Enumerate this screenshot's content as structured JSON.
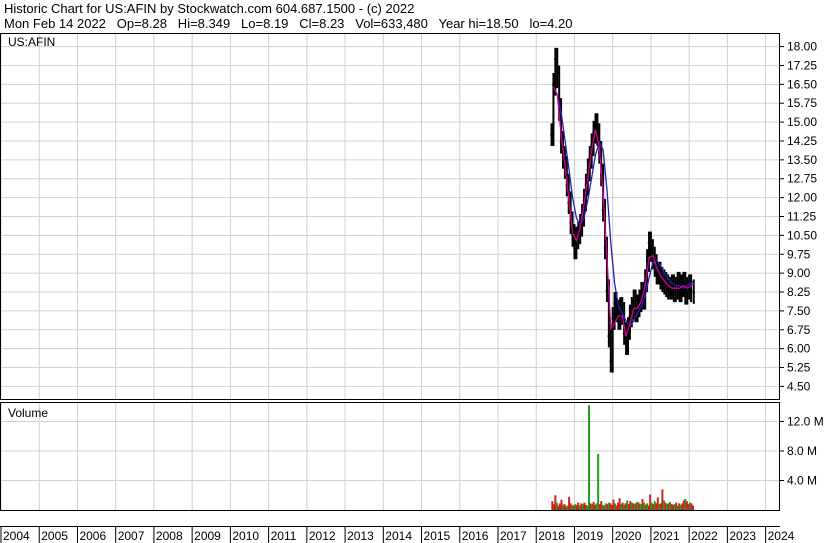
{
  "header": {
    "line1": "Historic Chart for US:AFIN by Stockwatch.com 604.687.1500 - (c) 2022",
    "line2": "Mon Feb 14 2022   Op=8.28   Hi=8.349   Lo=8.19   Cl=8.23   Vol=633,480   Year hi=18.50   lo=4.20"
  },
  "colors": {
    "grid": "#d0d0d0",
    "frame": "#000000",
    "price_bar": "#000000",
    "ma_short": "#d00090",
    "ma_long": "#2020c0",
    "vol_up": "#20a020",
    "vol_down": "#d02020"
  },
  "chart_data": [
    {
      "type": "line",
      "panel": "price",
      "title": "US:AFIN",
      "x_categories": [
        "2004",
        "2005",
        "2006",
        "2007",
        "2008",
        "2009",
        "2010",
        "2011",
        "2012",
        "2013",
        "2014",
        "2015",
        "2016",
        "2017",
        "2018",
        "2019",
        "2020",
        "2021",
        "2022",
        "2023",
        "2024"
      ],
      "y_ticks": [
        "18.00",
        "17.25",
        "16.50",
        "15.75",
        "15.00",
        "14.25",
        "13.50",
        "12.75",
        "12.00",
        "11.25",
        "10.50",
        "9.75",
        "9.00",
        "8.25",
        "7.50",
        "6.75",
        "6.00",
        "5.25",
        "4.50"
      ],
      "ylim": [
        4.0,
        18.5
      ],
      "grid": true,
      "series": [
        {
          "role": "price",
          "x": [
            2018.4,
            2018.45,
            2018.5,
            2018.55,
            2018.6,
            2018.65,
            2018.7,
            2018.75,
            2018.8,
            2018.85,
            2018.9,
            2018.95,
            2019.0,
            2019.05,
            2019.1,
            2019.15,
            2019.2,
            2019.25,
            2019.3,
            2019.35,
            2019.4,
            2019.45,
            2019.5,
            2019.55,
            2019.6,
            2019.65,
            2019.7,
            2019.75,
            2019.8,
            2019.85,
            2019.9,
            2019.95,
            2020.0,
            2020.05,
            2020.1,
            2020.15,
            2020.2,
            2020.25,
            2020.3,
            2020.35,
            2020.4,
            2020.45,
            2020.5,
            2020.55,
            2020.6,
            2020.65,
            2020.7,
            2020.75,
            2020.8,
            2020.85,
            2020.9,
            2020.95,
            2021.0,
            2021.05,
            2021.1,
            2021.15,
            2021.2,
            2021.25,
            2021.3,
            2021.35,
            2021.4,
            2021.45,
            2021.5,
            2021.55,
            2021.6,
            2021.65,
            2021.7,
            2021.75,
            2021.8,
            2021.85,
            2021.9,
            2021.95,
            2022.0,
            2022.05,
            2022.12
          ],
          "y": [
            14.5,
            16.5,
            17.5,
            16.8,
            15.5,
            14.2,
            13.6,
            13.2,
            12.5,
            11.8,
            11.0,
            10.5,
            10.0,
            10.4,
            10.6,
            10.9,
            11.3,
            11.9,
            12.5,
            13.1,
            13.6,
            14.1,
            14.6,
            14.9,
            14.5,
            13.8,
            12.9,
            11.5,
            10.0,
            8.3,
            6.5,
            5.5,
            7.2,
            7.8,
            7.5,
            7.2,
            7.6,
            7.4,
            6.6,
            6.2,
            6.8,
            7.3,
            7.6,
            7.9,
            7.5,
            7.7,
            7.9,
            8.2,
            8.0,
            8.7,
            9.5,
            10.2,
            9.9,
            9.6,
            9.3,
            9.0,
            9.0,
            8.8,
            8.7,
            8.6,
            8.5,
            8.4,
            8.4,
            8.5,
            8.3,
            8.4,
            8.6,
            8.3,
            8.5,
            8.6,
            8.2,
            8.4,
            8.5,
            8.3,
            8.23
          ]
        },
        {
          "role": "moving-average-short",
          "x": [
            2018.45,
            2018.55,
            2018.65,
            2018.75,
            2018.85,
            2018.95,
            2019.05,
            2019.15,
            2019.25,
            2019.35,
            2019.45,
            2019.55,
            2019.65,
            2019.75,
            2019.85,
            2019.95,
            2020.05,
            2020.15,
            2020.25,
            2020.35,
            2020.45,
            2020.55,
            2020.65,
            2020.75,
            2020.85,
            2020.95,
            2021.05,
            2021.15,
            2021.25,
            2021.35,
            2021.45,
            2021.55,
            2021.65,
            2021.75,
            2021.85,
            2021.95,
            2022.05,
            2022.12
          ],
          "y": [
            16.4,
            16.1,
            14.5,
            13.3,
            12.0,
            10.6,
            10.3,
            10.8,
            11.7,
            12.8,
            13.9,
            14.7,
            14.0,
            12.2,
            9.6,
            6.8,
            7.0,
            7.3,
            7.3,
            6.5,
            7.0,
            7.6,
            7.6,
            7.9,
            8.5,
            9.6,
            9.7,
            9.2,
            8.9,
            8.7,
            8.5,
            8.4,
            8.4,
            8.4,
            8.5,
            8.4,
            8.5,
            8.6
          ]
        },
        {
          "role": "moving-average-long",
          "x": [
            2018.55,
            2018.65,
            2018.75,
            2018.85,
            2018.95,
            2019.05,
            2019.15,
            2019.25,
            2019.35,
            2019.45,
            2019.55,
            2019.65,
            2019.75,
            2019.85,
            2019.95,
            2020.05,
            2020.15,
            2020.25,
            2020.35,
            2020.45,
            2020.55,
            2020.65,
            2020.75,
            2020.85,
            2020.95,
            2021.05,
            2021.15,
            2021.25,
            2021.35,
            2021.45,
            2021.55,
            2021.65,
            2021.75,
            2021.85,
            2021.95,
            2022.05,
            2022.12
          ],
          "y": [
            16.0,
            15.4,
            14.3,
            13.2,
            12.0,
            11.2,
            10.9,
            11.2,
            11.9,
            12.8,
            13.7,
            14.2,
            13.9,
            12.3,
            10.2,
            8.6,
            7.7,
            7.4,
            7.1,
            6.9,
            7.1,
            7.4,
            7.7,
            8.1,
            8.8,
            9.4,
            9.5,
            9.3,
            9.0,
            8.8,
            8.6,
            8.5,
            8.5,
            8.4,
            8.5,
            8.6,
            8.7
          ]
        }
      ]
    },
    {
      "type": "bar",
      "panel": "volume",
      "title": "Volume",
      "y_ticks": [
        "12.0 M",
        "8.0 M",
        "4.0 M"
      ],
      "ylim": [
        0,
        14.5
      ],
      "unit": "M",
      "grid": true,
      "series": [
        {
          "name": "Volume",
          "x": [
            2018.42,
            2018.46,
            2018.5,
            2018.54,
            2018.58,
            2018.62,
            2018.66,
            2018.7,
            2018.74,
            2018.78,
            2018.82,
            2018.86,
            2018.9,
            2018.94,
            2018.98,
            2019.02,
            2019.06,
            2019.1,
            2019.14,
            2019.18,
            2019.22,
            2019.26,
            2019.3,
            2019.34,
            2019.38,
            2019.42,
            2019.46,
            2019.5,
            2019.54,
            2019.58,
            2019.62,
            2019.66,
            2019.7,
            2019.74,
            2019.78,
            2019.82,
            2019.86,
            2019.9,
            2019.94,
            2019.98,
            2020.02,
            2020.06,
            2020.1,
            2020.14,
            2020.18,
            2020.22,
            2020.26,
            2020.3,
            2020.34,
            2020.38,
            2020.42,
            2020.46,
            2020.5,
            2020.54,
            2020.58,
            2020.62,
            2020.66,
            2020.7,
            2020.74,
            2020.78,
            2020.82,
            2020.86,
            2020.9,
            2020.94,
            2020.98,
            2021.02,
            2021.06,
            2021.1,
            2021.14,
            2021.18,
            2021.22,
            2021.26,
            2021.3,
            2021.34,
            2021.38,
            2021.42,
            2021.46,
            2021.5,
            2021.54,
            2021.58,
            2021.62,
            2021.66,
            2021.7,
            2021.74,
            2021.78,
            2021.82,
            2021.86,
            2021.9,
            2021.94,
            2021.98,
            2022.02,
            2022.06,
            2022.1
          ],
          "values": [
            1.2,
            0.8,
            2.0,
            1.0,
            0.6,
            0.9,
            1.4,
            0.7,
            0.8,
            0.5,
            0.6,
            1.8,
            0.9,
            0.7,
            0.6,
            0.8,
            0.7,
            1.0,
            0.6,
            0.9,
            0.8,
            1.0,
            0.7,
            0.6,
            14.2,
            0.9,
            0.8,
            1.1,
            0.7,
            0.9,
            7.6,
            0.8,
            1.2,
            0.7,
            0.6,
            0.9,
            0.8,
            1.0,
            0.9,
            0.7,
            1.4,
            0.9,
            0.6,
            1.0,
            1.6,
            0.8,
            1.0,
            0.7,
            0.9,
            1.3,
            0.8,
            1.2,
            1.0,
            0.9,
            0.8,
            1.0,
            1.1,
            0.9,
            0.8,
            1.5,
            1.0,
            0.7,
            0.9,
            0.6,
            2.1,
            1.0,
            0.8,
            1.2,
            0.9,
            1.7,
            0.8,
            0.9,
            2.8,
            1.3,
            1.0,
            0.8,
            0.9,
            1.1,
            0.8,
            0.7,
            0.8,
            1.0,
            0.6,
            0.9,
            0.7,
            0.9,
            1.3,
            1.5,
            1.2,
            0.8,
            1.0,
            0.9,
            0.6
          ],
          "direction": [
            "down",
            "down",
            "down",
            "up",
            "down",
            "down",
            "down",
            "up",
            "down",
            "down",
            "up",
            "down",
            "down",
            "up",
            "down",
            "up",
            "down",
            "down",
            "up",
            "down",
            "up",
            "down",
            "down",
            "up",
            "up",
            "down",
            "up",
            "down",
            "down",
            "up",
            "up",
            "down",
            "down",
            "up",
            "down",
            "up",
            "down",
            "up",
            "down",
            "down",
            "down",
            "up",
            "down",
            "down",
            "down",
            "up",
            "down",
            "up",
            "down",
            "up",
            "down",
            "down",
            "up",
            "down",
            "up",
            "down",
            "up",
            "down",
            "up",
            "down",
            "up",
            "down",
            "up",
            "down",
            "down",
            "up",
            "down",
            "up",
            "down",
            "down",
            "up",
            "down",
            "down",
            "up",
            "down",
            "up",
            "down",
            "up",
            "down",
            "down",
            "up",
            "down",
            "up",
            "down",
            "up",
            "down",
            "down",
            "up",
            "down",
            "down",
            "up",
            "down",
            "down"
          ]
        }
      ]
    }
  ]
}
